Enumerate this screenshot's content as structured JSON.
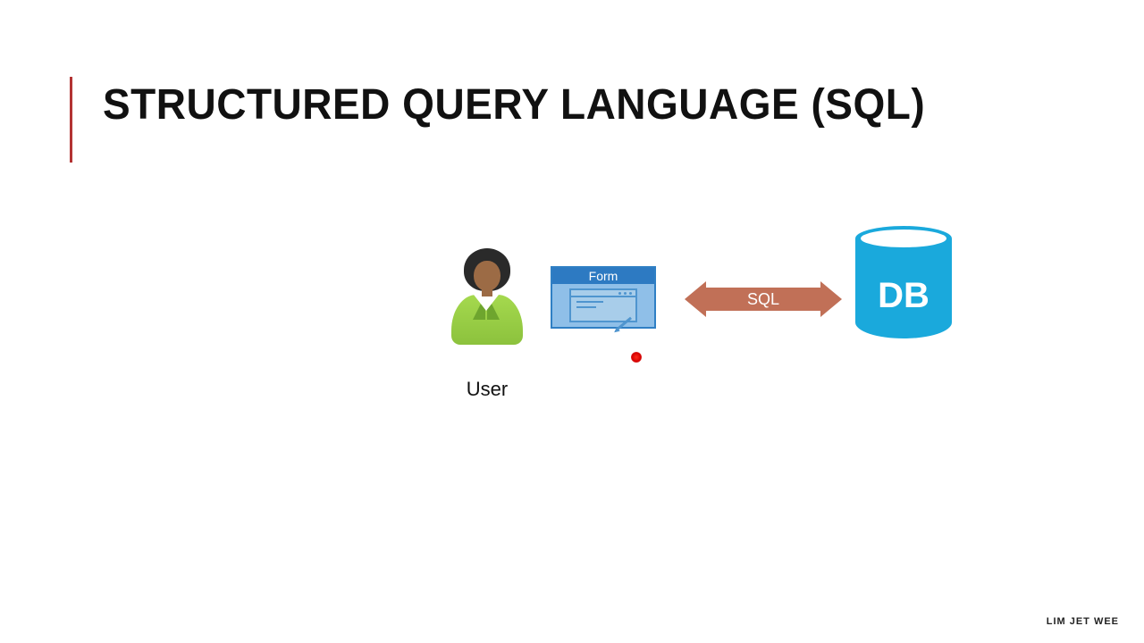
{
  "title": "STRUCTURED QUERY LANGUAGE (SQL)",
  "diagram": {
    "user_label": "User",
    "form_label": "Form",
    "arrow_label": "SQL",
    "db_label": "DB"
  },
  "footer": "LIM JET WEE"
}
